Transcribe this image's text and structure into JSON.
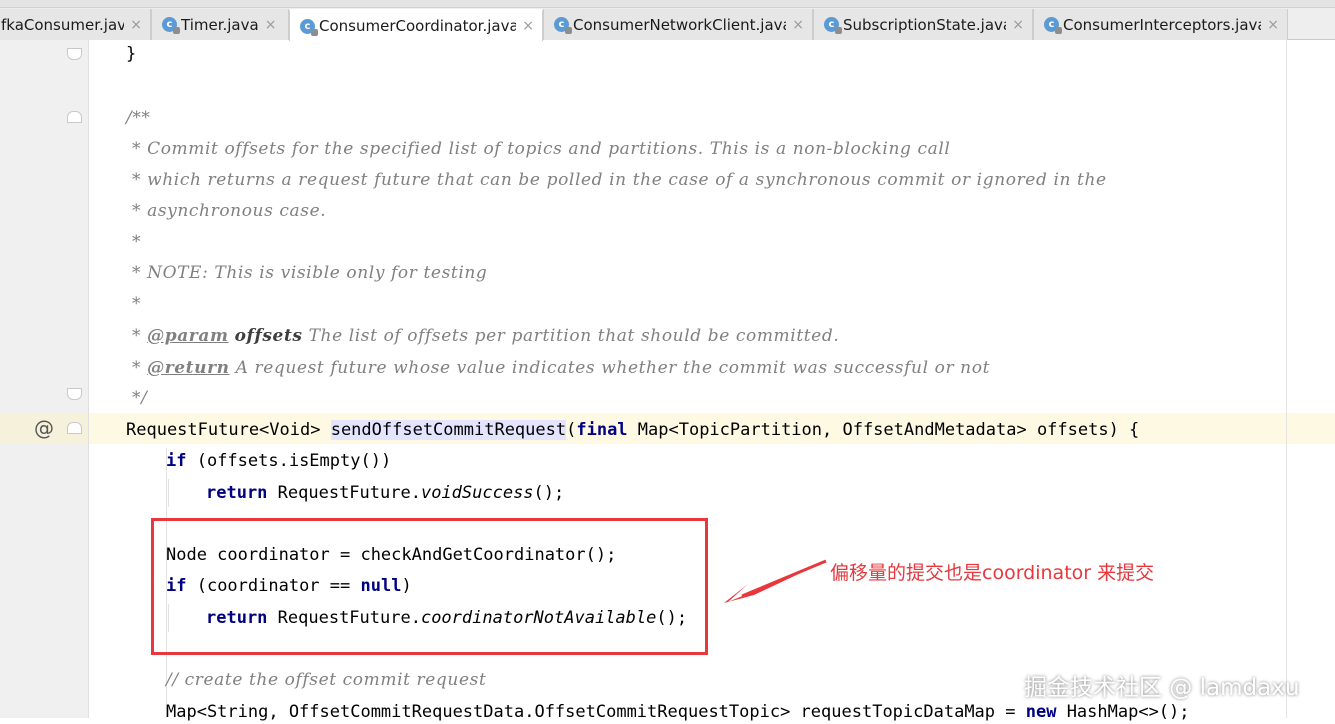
{
  "tabs": [
    {
      "label": "fkaConsumer.java",
      "active": false,
      "icon": "class-icon"
    },
    {
      "label": "Timer.java",
      "active": false,
      "icon": "class-icon"
    },
    {
      "label": "ConsumerCoordinator.java",
      "active": true,
      "icon": "class-icon"
    },
    {
      "label": "ConsumerNetworkClient.java",
      "active": false,
      "icon": "class-icon"
    },
    {
      "label": "SubscriptionState.java",
      "active": false,
      "icon": "class-icon"
    },
    {
      "label": "ConsumerInterceptors.java",
      "active": false,
      "icon": "class-icon"
    }
  ],
  "tab_close_glyph": "×",
  "gutter": {
    "override_marker": "@"
  },
  "code": {
    "l0_brace": "}",
    "l1": "/**",
    "l2": " * Commit offsets for the specified list of topics and partitions. This is a non-blocking call",
    "l3": " * which returns a request future that can be polled in the case of a synchronous commit or ignored in the",
    "l4": " * asynchronous case.",
    "l5": " *",
    "l6": " * NOTE: This is visible only for testing",
    "l7": " *",
    "l8_prefix": " * ",
    "l8_tag": "@param",
    "l8_name": "offsets",
    "l8_rest": " The list of offsets per partition that should be committed.",
    "l9_prefix": " * ",
    "l9_tag": "@return",
    "l9_rest": " A request future whose value indicates whether the commit was successful or not",
    "l10": " */",
    "sig_type": "RequestFuture<Void> ",
    "sig_name": "sendOffsetCommitRequest",
    "sig_open": "(",
    "sig_final": "final",
    "sig_rest": " Map<TopicPartition, OffsetAndMetadata> offsets) {",
    "if1_kw": "if",
    "if1_rest": " (offsets.isEmpty())",
    "ret1_kw": "return",
    "ret1_a": " RequestFuture.",
    "ret1_m": "voidSuccess",
    "ret1_b": "();",
    "node_line": "Node coordinator = checkAndGetCoordinator();",
    "if2_kw": "if",
    "if2_a": " (coordinator == ",
    "if2_null": "null",
    "if2_b": ")",
    "ret2_kw": "return",
    "ret2_a": " RequestFuture.",
    "ret2_m": "coordinatorNotAvailable",
    "ret2_b": "();",
    "comment_line": "// create the offset commit request",
    "map_a": "Map<String, OffsetCommitRequestData.OffsetCommitRequestTopic> requestTopicDataMap = ",
    "map_new": "new",
    "map_b": " HashMap<>();"
  },
  "annotation": {
    "text": "偏移量的提交也是coordinator 来提交",
    "color": "#e8383d"
  },
  "watermark": "掘金技术社区 @ lamdaxu",
  "colors": {
    "keyword": "#000080",
    "comment": "#808080",
    "caret_row": "#fdf9e3",
    "highlight": "#e4e4ff"
  }
}
